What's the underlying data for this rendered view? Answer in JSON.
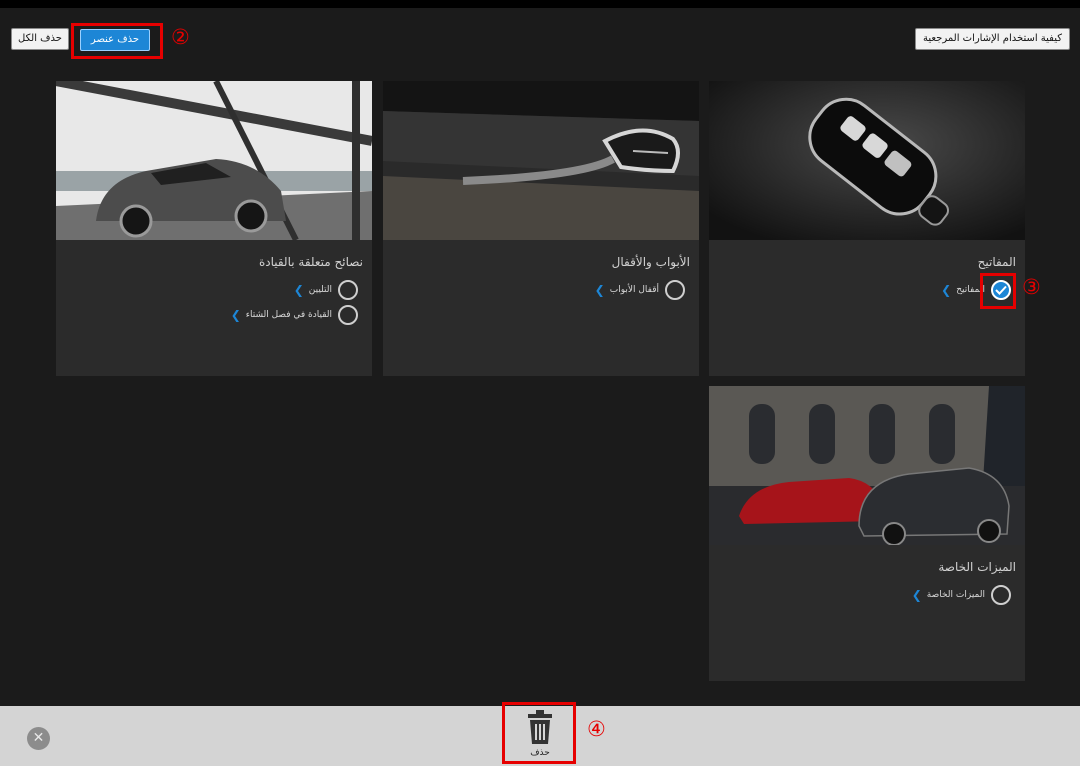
{
  "toolbar": {
    "how_to_use_label": "كيفية استخدام الإشارات المرجعية",
    "delete_item_label": "حذف عنصر",
    "delete_all_label": "حذف الكل"
  },
  "markers": {
    "two": "②",
    "three": "③",
    "four": "④"
  },
  "cards": [
    {
      "title": "المفاتيح",
      "items": [
        {
          "label": "المفاتيح",
          "checked": true
        }
      ]
    },
    {
      "title": "الأبواب والأقفال",
      "items": [
        {
          "label": "أقفال الأبواب",
          "checked": false
        }
      ]
    },
    {
      "title": "نصائح متعلقة بالقيادة",
      "items": [
        {
          "label": "التليين",
          "checked": false
        },
        {
          "label": "القيادة في فصل الشتاء",
          "checked": false
        }
      ]
    },
    {
      "title": "الميزات الخاصة",
      "items": [
        {
          "label": "الميزات الخاصة",
          "checked": false
        }
      ]
    }
  ],
  "bottom": {
    "delete_label": "حذف",
    "close_icon": "close-icon",
    "trash_icon": "trash-icon"
  },
  "colors": {
    "accent": "#1d86d6",
    "highlight": "#e60000",
    "background": "#1b1b1b",
    "card": "#2b2b2b"
  }
}
